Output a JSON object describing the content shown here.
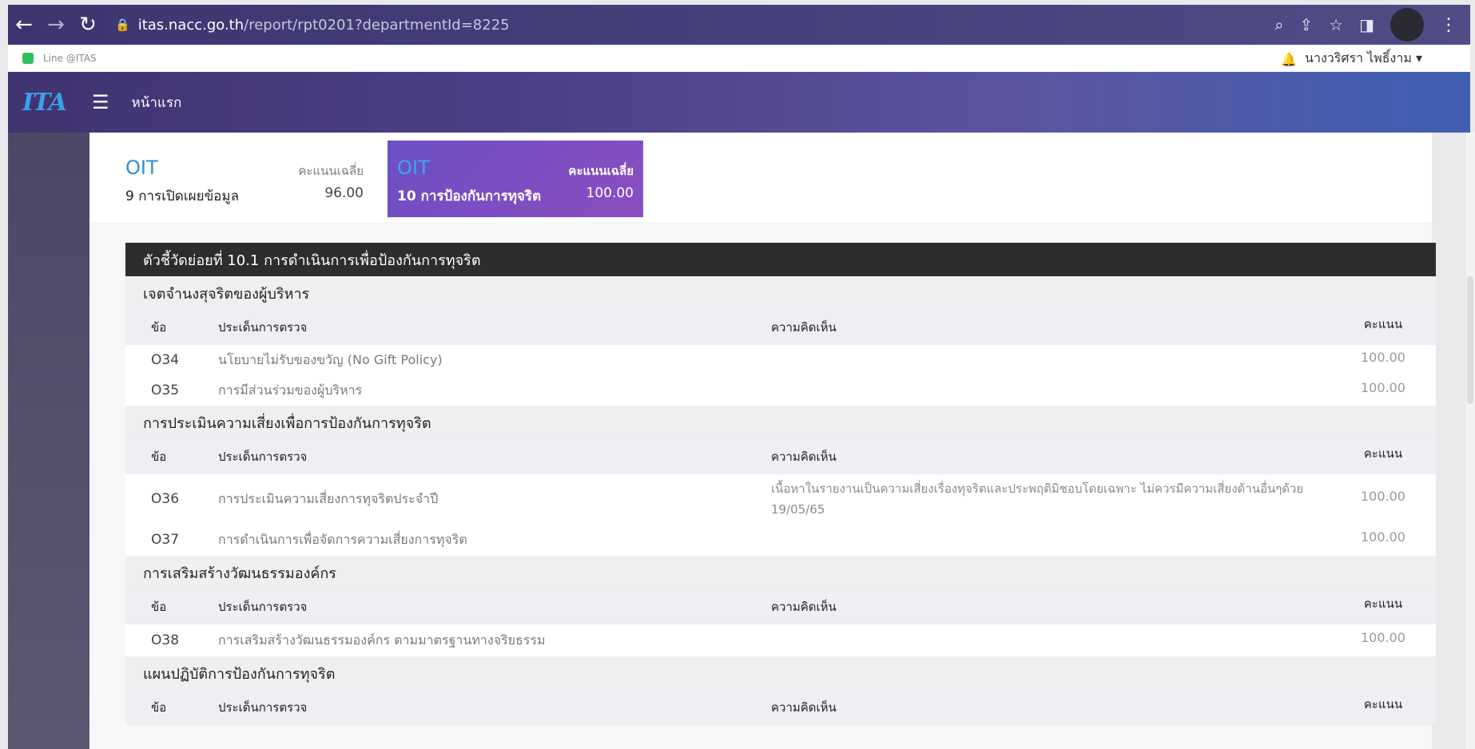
{
  "browser": {
    "url_host": "itas.nacc.go.th",
    "url_path": "/report/rpt0201?departmentId=8225"
  },
  "bookmarks": {
    "line_label": "Line @ITAS"
  },
  "user": {
    "name": "นางวริศรา ไพธิ์งาม ▾"
  },
  "app": {
    "logo_text": "ITA",
    "home_label": "หน้าแรก"
  },
  "score_cards": [
    {
      "code": "OIT",
      "avg_label": "คะแนนเฉลี่ย",
      "name": "9 การเปิดเผยข้อมูล",
      "score": "96.00"
    },
    {
      "code": "OIT",
      "avg_label": "คะแนนเฉลี่ย",
      "name": "10 การป้องกันการทุจริต",
      "score": "100.00"
    }
  ],
  "indicator": {
    "title": "ตัวชี้วัดย่อยที่ 10.1 การดำเนินการเพื่อป้องกันการทุจริต"
  },
  "columns": {
    "no": "ข้อ",
    "topic": "ประเด็นการตรวจ",
    "comment": "ความคิดเห็น",
    "score": "คะแนน"
  },
  "sections": [
    {
      "title": "เจตจำนงสุจริตของผู้บริหาร",
      "rows": [
        {
          "no": "O34",
          "topic": "นโยบายไม่รับของขวัญ (No Gift Policy)",
          "comment": "",
          "score": "100.00"
        },
        {
          "no": "O35",
          "topic": "การมีส่วนร่วมของผู้บริหาร",
          "comment": "",
          "score": "100.00"
        }
      ]
    },
    {
      "title": "การประเมินความเสี่ยงเพื่อการป้องกันการทุจริต",
      "rows": [
        {
          "no": "O36",
          "topic": "การประเมินความเสี่ยงการทุจริตประจำปี",
          "comment": "เนื้อหาในรายงานเป็นความเสี่ยงเรื่องทุจริตและประพฤติมิชอบโดยเฉพาะ ไม่ควรมีความเสี่ยงด้านอื่นๆด้วย 19/05/65",
          "score": "100.00"
        },
        {
          "no": "O37",
          "topic": "การดำเนินการเพื่อจัดการความเสี่ยงการทุจริต",
          "comment": "",
          "score": "100.00"
        }
      ]
    },
    {
      "title": "การเสริมสร้างวัฒนธรรมองค์กร",
      "rows": [
        {
          "no": "O38",
          "topic": "การเสริมสร้างวัฒนธรรมองค์กร ตามมาตรฐานทางจริยธรรม",
          "comment": "",
          "score": "100.00"
        }
      ]
    },
    {
      "title": "แผนปฏิบัติการป้องกันการทุจริต",
      "rows": []
    }
  ]
}
